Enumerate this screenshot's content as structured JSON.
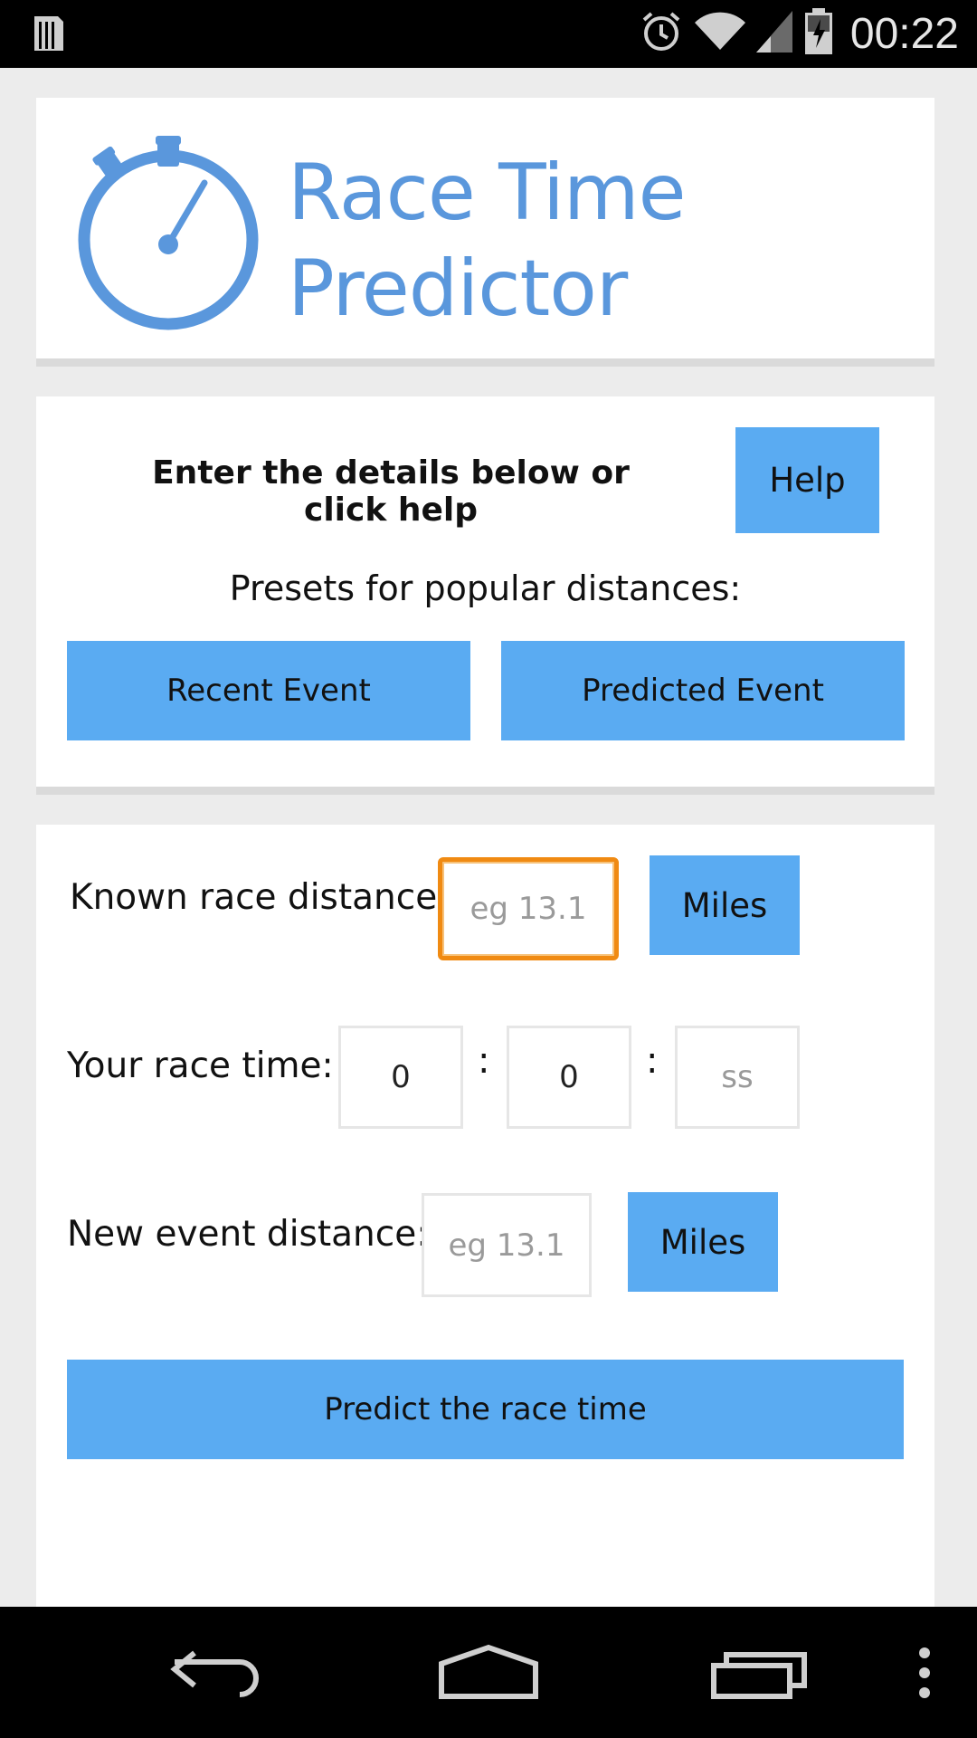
{
  "status_bar": {
    "time": "00:22",
    "icons": [
      "sim-card-icon",
      "alarm-clock-icon",
      "wifi-icon",
      "signal-icon",
      "battery-icon"
    ]
  },
  "header": {
    "title_line1": "Race Time",
    "title_line2": "Predictor",
    "logo_icon": "stopwatch-icon",
    "accent_color": "#5a97dc"
  },
  "intro": {
    "instruction": "Enter the details below or click help",
    "help_label": "Help",
    "presets_label": "Presets for popular distances:",
    "recent_event_label": "Recent Event",
    "predicted_event_label": "Predicted Event"
  },
  "form": {
    "known_distance_label": "Known race distance:",
    "known_distance_placeholder": "eg 13.1",
    "known_distance_value": "",
    "known_unit_label": "Miles",
    "race_time_label": "Your race time:",
    "hours_value": "0",
    "minutes_value": "0",
    "seconds_placeholder": "ss",
    "separator": ":",
    "new_distance_label": "New event distance:",
    "new_distance_placeholder": "eg 13.1",
    "new_unit_label": "Miles",
    "predict_label": "Predict the race time",
    "button_color": "#5aabf2",
    "focus_color": "#f08a12"
  },
  "nav_bar": {
    "icons": [
      "back-icon",
      "home-icon",
      "recent-apps-icon",
      "overflow-menu-icon"
    ]
  }
}
